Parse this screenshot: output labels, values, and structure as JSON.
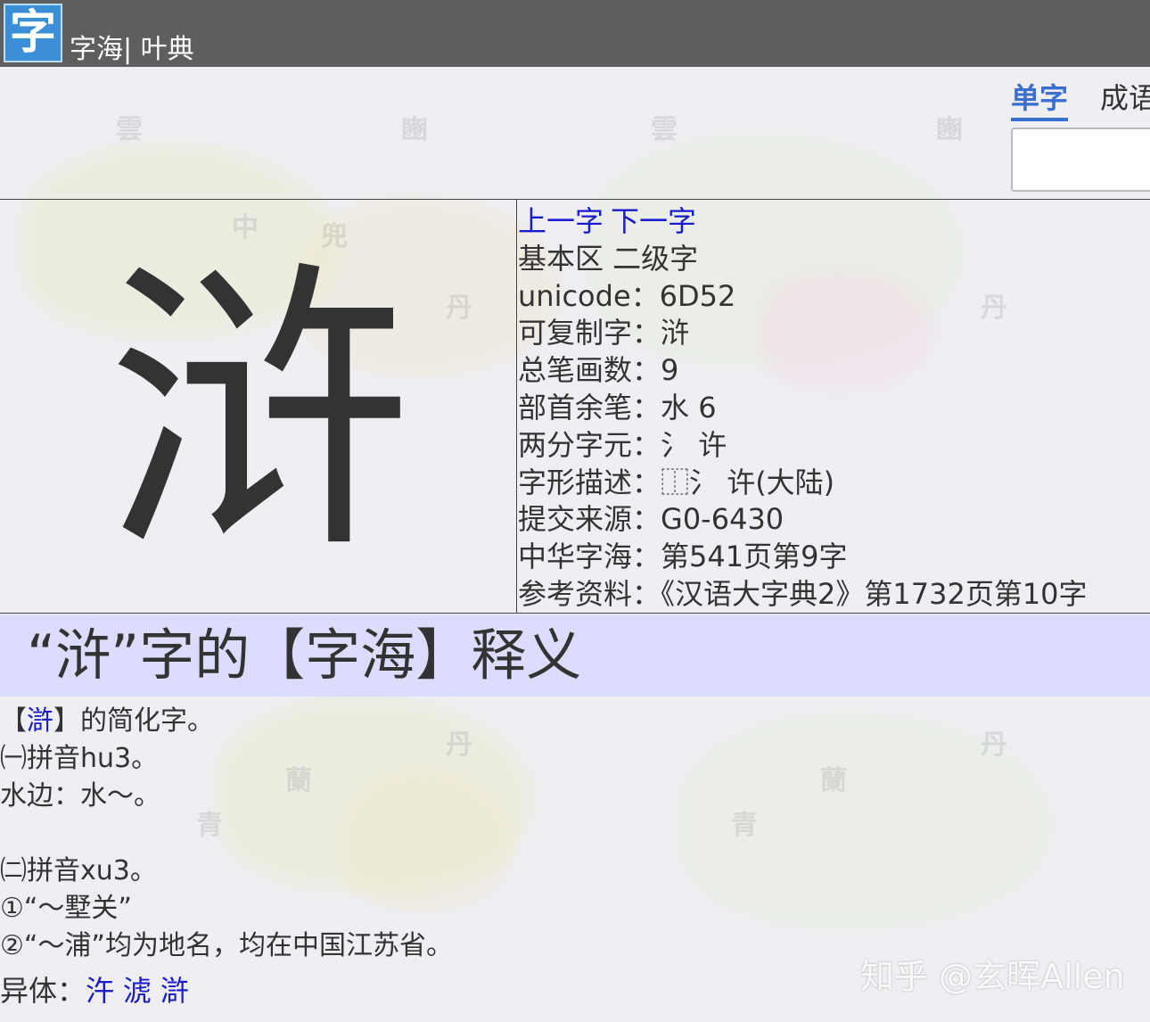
{
  "header": {
    "logo_char": "字",
    "site_name": "字海| 叶典"
  },
  "search": {
    "tabs": [
      {
        "label": "单字",
        "active": true
      },
      {
        "label": "成语",
        "active": false
      }
    ],
    "placeholder": ""
  },
  "character": {
    "glyph": "浒",
    "nav": {
      "prev": "上一字",
      "next": "下一字"
    },
    "info": [
      {
        "label": "基本区 二级字",
        "value": ""
      },
      {
        "label": "unicode：",
        "value": "6D52"
      },
      {
        "label": "可复制字：",
        "value": "浒"
      },
      {
        "label": "总笔画数：",
        "value": "9"
      },
      {
        "label": "部首余笔：",
        "value": "水 6"
      },
      {
        "label": "两分字元：",
        "value": "氵 许"
      },
      {
        "label": "字形描述：",
        "value": "⿰氵 许(大陆)"
      },
      {
        "label": "提交来源：",
        "value": "G0-6430"
      },
      {
        "label": "中华字海：",
        "value": "第541页第9字"
      },
      {
        "label": "参考资料：",
        "value": "《汉语大字典2》第1732页第10字"
      }
    ]
  },
  "definition": {
    "heading": "“浒”字的【字海】释义",
    "lines": {
      "l1_prefix": "【",
      "l1_link": "滸",
      "l1_suffix": "】的简化字。",
      "l2": "㈠拼音hu3。",
      "l3": "水边：水～。",
      "l4": "㈡拼音xu3。",
      "l5": "①“～墅关”",
      "l6": "②“～浦”均为地名，均在中国江苏省。"
    },
    "variants": {
      "label": "异体：",
      "items": [
        "汻",
        "淲",
        "滸"
      ]
    }
  },
  "credit": "知乎 @玄晖Allen"
}
